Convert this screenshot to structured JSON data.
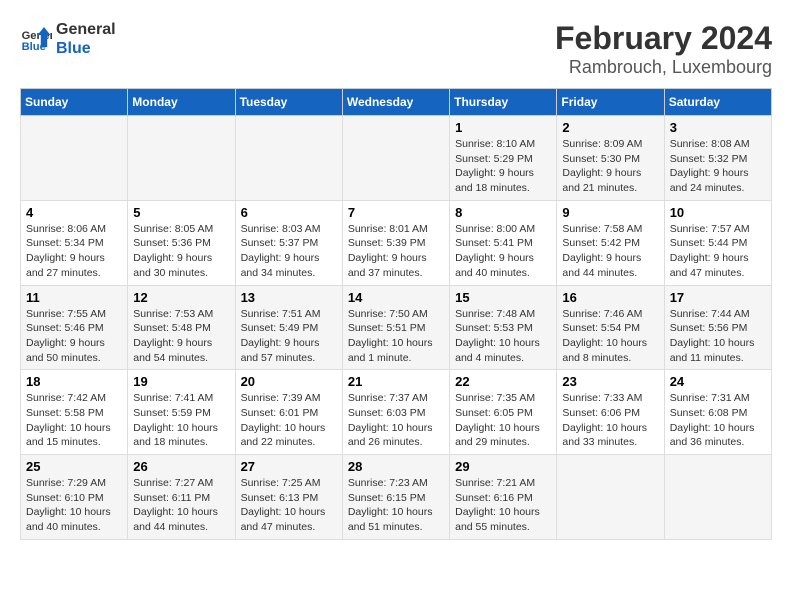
{
  "header": {
    "logo_general": "General",
    "logo_blue": "Blue",
    "main_title": "February 2024",
    "subtitle": "Rambrouch, Luxembourg"
  },
  "weekdays": [
    "Sunday",
    "Monday",
    "Tuesday",
    "Wednesday",
    "Thursday",
    "Friday",
    "Saturday"
  ],
  "weeks": [
    [
      {
        "day": "",
        "info": ""
      },
      {
        "day": "",
        "info": ""
      },
      {
        "day": "",
        "info": ""
      },
      {
        "day": "",
        "info": ""
      },
      {
        "day": "1",
        "info": "Sunrise: 8:10 AM\nSunset: 5:29 PM\nDaylight: 9 hours\nand 18 minutes."
      },
      {
        "day": "2",
        "info": "Sunrise: 8:09 AM\nSunset: 5:30 PM\nDaylight: 9 hours\nand 21 minutes."
      },
      {
        "day": "3",
        "info": "Sunrise: 8:08 AM\nSunset: 5:32 PM\nDaylight: 9 hours\nand 24 minutes."
      }
    ],
    [
      {
        "day": "4",
        "info": "Sunrise: 8:06 AM\nSunset: 5:34 PM\nDaylight: 9 hours\nand 27 minutes."
      },
      {
        "day": "5",
        "info": "Sunrise: 8:05 AM\nSunset: 5:36 PM\nDaylight: 9 hours\nand 30 minutes."
      },
      {
        "day": "6",
        "info": "Sunrise: 8:03 AM\nSunset: 5:37 PM\nDaylight: 9 hours\nand 34 minutes."
      },
      {
        "day": "7",
        "info": "Sunrise: 8:01 AM\nSunset: 5:39 PM\nDaylight: 9 hours\nand 37 minutes."
      },
      {
        "day": "8",
        "info": "Sunrise: 8:00 AM\nSunset: 5:41 PM\nDaylight: 9 hours\nand 40 minutes."
      },
      {
        "day": "9",
        "info": "Sunrise: 7:58 AM\nSunset: 5:42 PM\nDaylight: 9 hours\nand 44 minutes."
      },
      {
        "day": "10",
        "info": "Sunrise: 7:57 AM\nSunset: 5:44 PM\nDaylight: 9 hours\nand 47 minutes."
      }
    ],
    [
      {
        "day": "11",
        "info": "Sunrise: 7:55 AM\nSunset: 5:46 PM\nDaylight: 9 hours\nand 50 minutes."
      },
      {
        "day": "12",
        "info": "Sunrise: 7:53 AM\nSunset: 5:48 PM\nDaylight: 9 hours\nand 54 minutes."
      },
      {
        "day": "13",
        "info": "Sunrise: 7:51 AM\nSunset: 5:49 PM\nDaylight: 9 hours\nand 57 minutes."
      },
      {
        "day": "14",
        "info": "Sunrise: 7:50 AM\nSunset: 5:51 PM\nDaylight: 10 hours\nand 1 minute."
      },
      {
        "day": "15",
        "info": "Sunrise: 7:48 AM\nSunset: 5:53 PM\nDaylight: 10 hours\nand 4 minutes."
      },
      {
        "day": "16",
        "info": "Sunrise: 7:46 AM\nSunset: 5:54 PM\nDaylight: 10 hours\nand 8 minutes."
      },
      {
        "day": "17",
        "info": "Sunrise: 7:44 AM\nSunset: 5:56 PM\nDaylight: 10 hours\nand 11 minutes."
      }
    ],
    [
      {
        "day": "18",
        "info": "Sunrise: 7:42 AM\nSunset: 5:58 PM\nDaylight: 10 hours\nand 15 minutes."
      },
      {
        "day": "19",
        "info": "Sunrise: 7:41 AM\nSunset: 5:59 PM\nDaylight: 10 hours\nand 18 minutes."
      },
      {
        "day": "20",
        "info": "Sunrise: 7:39 AM\nSunset: 6:01 PM\nDaylight: 10 hours\nand 22 minutes."
      },
      {
        "day": "21",
        "info": "Sunrise: 7:37 AM\nSunset: 6:03 PM\nDaylight: 10 hours\nand 26 minutes."
      },
      {
        "day": "22",
        "info": "Sunrise: 7:35 AM\nSunset: 6:05 PM\nDaylight: 10 hours\nand 29 minutes."
      },
      {
        "day": "23",
        "info": "Sunrise: 7:33 AM\nSunset: 6:06 PM\nDaylight: 10 hours\nand 33 minutes."
      },
      {
        "day": "24",
        "info": "Sunrise: 7:31 AM\nSunset: 6:08 PM\nDaylight: 10 hours\nand 36 minutes."
      }
    ],
    [
      {
        "day": "25",
        "info": "Sunrise: 7:29 AM\nSunset: 6:10 PM\nDaylight: 10 hours\nand 40 minutes."
      },
      {
        "day": "26",
        "info": "Sunrise: 7:27 AM\nSunset: 6:11 PM\nDaylight: 10 hours\nand 44 minutes."
      },
      {
        "day": "27",
        "info": "Sunrise: 7:25 AM\nSunset: 6:13 PM\nDaylight: 10 hours\nand 47 minutes."
      },
      {
        "day": "28",
        "info": "Sunrise: 7:23 AM\nSunset: 6:15 PM\nDaylight: 10 hours\nand 51 minutes."
      },
      {
        "day": "29",
        "info": "Sunrise: 7:21 AM\nSunset: 6:16 PM\nDaylight: 10 hours\nand 55 minutes."
      },
      {
        "day": "",
        "info": ""
      },
      {
        "day": "",
        "info": ""
      }
    ]
  ]
}
